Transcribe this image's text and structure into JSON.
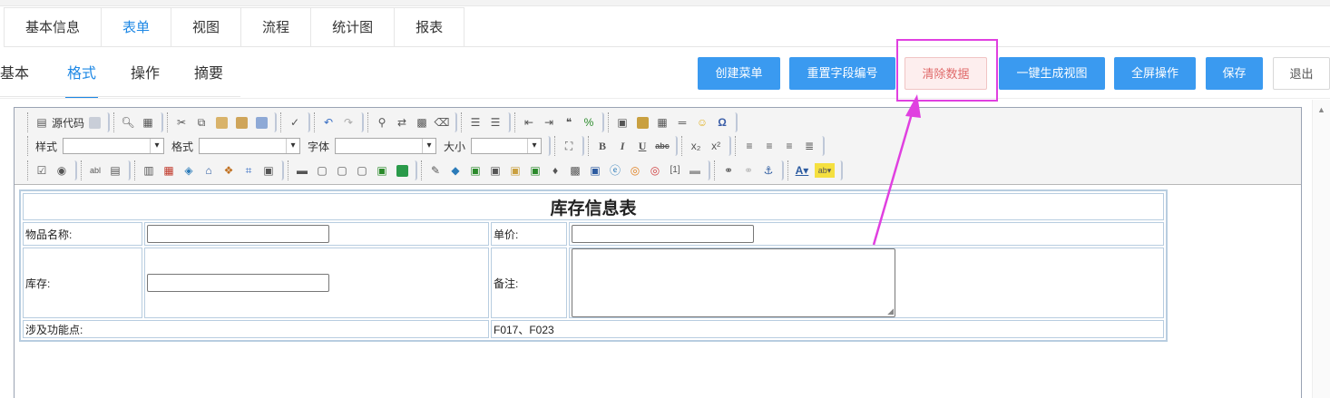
{
  "top_tabs": [
    "基本信息",
    "表单",
    "视图",
    "流程",
    "统计图",
    "报表"
  ],
  "sub_tabs": [
    "基本",
    "格式",
    "操作",
    "摘要"
  ],
  "buttons": {
    "create_menu": "创建菜单",
    "reset_field_no": "重置字段编号",
    "clear_data": "清除数据",
    "gen_view": "一键生成视图",
    "fullscreen": "全屏操作",
    "save": "保存",
    "exit": "退出"
  },
  "toolbar": {
    "source_code": "源代码",
    "style_label": "样式",
    "format_label": "格式",
    "font_label": "字体",
    "size_label": "大小"
  },
  "form": {
    "title": "库存信息表",
    "item_name_label": "物品名称:",
    "unit_price_label": "单价:",
    "stock_label": "库存:",
    "remark_label": "备注:",
    "features_label": "涉及功能点:",
    "features_value": "F017、F023"
  },
  "colors": {
    "accent": "#3a9af0",
    "highlight": "#e040e0",
    "feature_red": "#d32f2f"
  }
}
